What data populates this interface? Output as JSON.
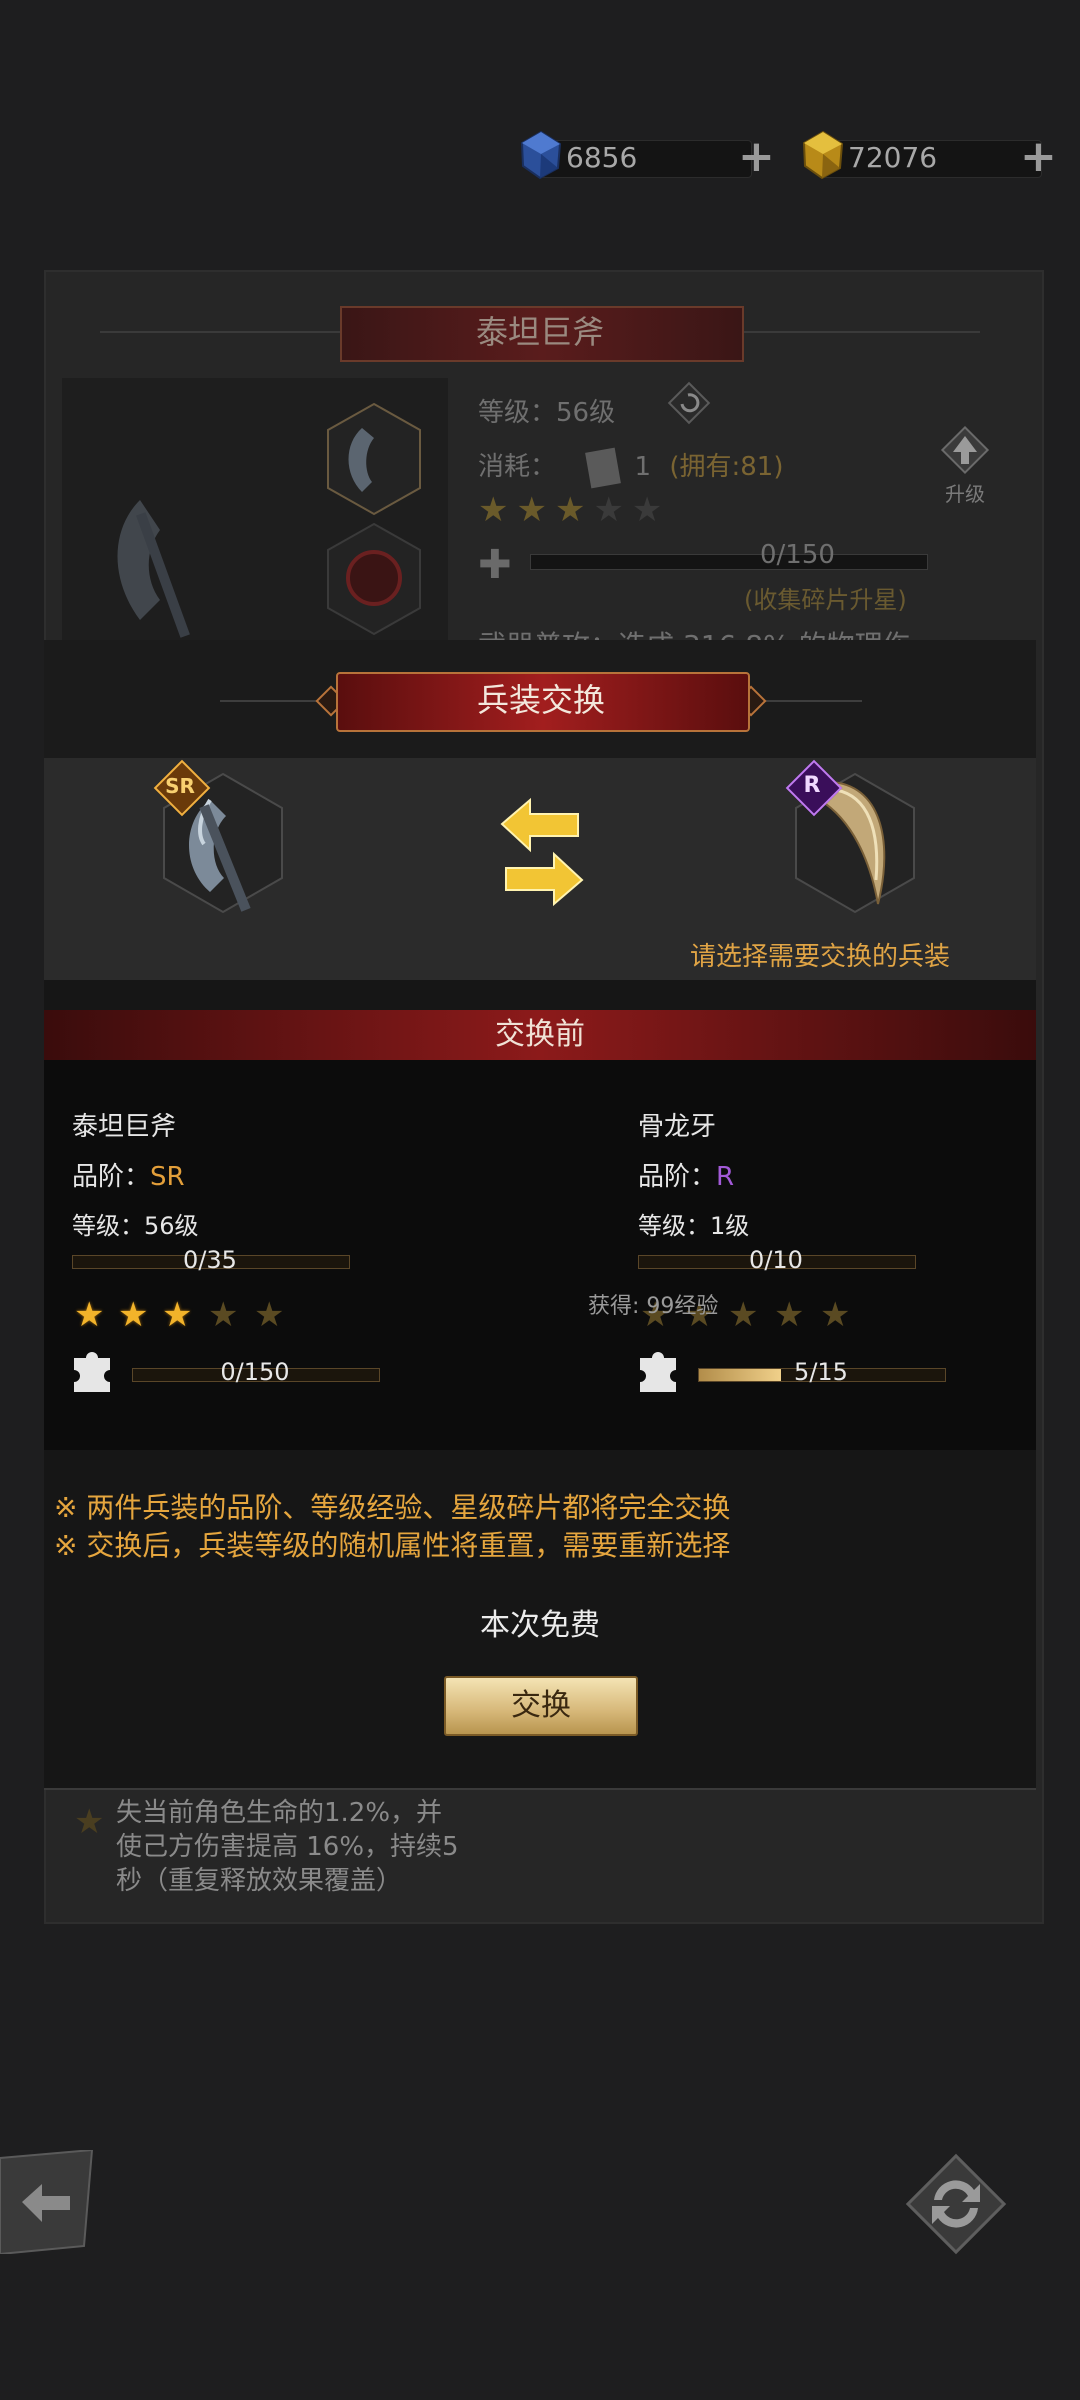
{
  "currency": {
    "gems": {
      "value": "6856",
      "icon": "blue-crystal-icon"
    },
    "gold": {
      "value": "72076",
      "icon": "gold-crystal-icon"
    }
  },
  "background": {
    "title": "泰坦巨斧",
    "level_label": "等级：",
    "level_value": "56级",
    "cost_label": "消耗：",
    "cost_amount": "1",
    "cost_owned": "(拥有:81)",
    "upgrade_label": "升级",
    "shard_progress": "0/150",
    "shard_hint": "(收集碎片升星)",
    "weapon_attack": "武器普攻：造成 316.8% 的物理伤",
    "skill_text_1": "失当前角色生命的1.2%，并",
    "skill_text_2": "使己方伤害提高 16%，持续5",
    "skill_text_3": "秒（重复释放效果覆盖）",
    "stars": 3
  },
  "modal": {
    "title": "兵装交换",
    "hint": "请选择需要交换的兵装",
    "section_title": "交换前",
    "left": {
      "name": "泰坦巨斧",
      "quality_label": "品阶：",
      "quality": "SR",
      "level_label": "等级：",
      "level": "56级",
      "xp": "0/35",
      "xp_fraction": 0,
      "stars": 3,
      "shards": "0/150",
      "shard_fraction": 0
    },
    "right": {
      "name": "骨龙牙",
      "quality_label": "品阶：",
      "quality": "R",
      "level_label": "等级：",
      "level": "1级",
      "xp": "0/10",
      "xp_fraction": 0,
      "stars": 0,
      "shards": "5/15",
      "shard_fraction": 0.333,
      "gain": "获得: 99经验"
    },
    "warning_1": "※ 两件兵装的品阶、等级经验、星级碎片都将完全交换",
    "warning_2": "※ 交换后，兵装等级的随机属性将重置，需要重新选择",
    "free_text": "本次免费",
    "swap_button": "交换"
  },
  "colors": {
    "sr": "#e39f3a",
    "r": "#a35ad8",
    "hint": "#e0a445",
    "banner": "#a21e1e"
  }
}
